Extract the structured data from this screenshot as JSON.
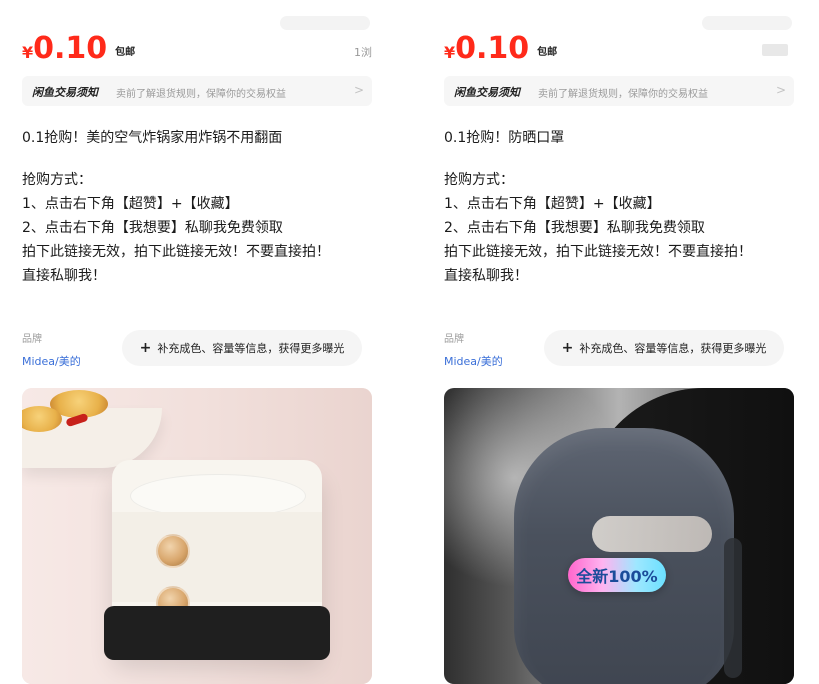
{
  "cards": [
    {
      "price_symbol": "¥",
      "price": "0.10",
      "shipping": "包邮",
      "price_meta": "1浏",
      "notice": {
        "title": "闲鱼交易须知",
        "desc": "卖前了解退货规则，保障你的交易权益",
        "chevron": ">"
      },
      "lines": [
        "0.1抢购！美的空气炸锅家用炸锅不用翻面",
        "抢购方式：",
        "1、点击右下角【超赞】+【收藏】",
        "2、点击右下角【我想要】私聊我免费领取",
        "拍下此链接无效，拍下此链接无效！不要直接拍！",
        "直接私聊我！"
      ],
      "brand_label": "品牌",
      "brand_value": "Midea/美的",
      "add_info": "补充成色、容量等信息，获得更多曝光",
      "plus": "+"
    },
    {
      "price_symbol": "¥",
      "price": "0.10",
      "shipping": "包邮",
      "notice": {
        "title": "闲鱼交易须知",
        "desc": "卖前了解退货规则，保障你的交易权益",
        "chevron": ">"
      },
      "lines": [
        "0.1抢购！防晒口罩",
        "抢购方式：",
        "1、点击右下角【超赞】+【收藏】",
        "2、点击右下角【我想要】私聊我免费领取",
        "拍下此链接无效，拍下此链接无效！不要直接拍！",
        "直接私聊我！"
      ],
      "brand_label": "品牌",
      "brand_value": "Midea/美的",
      "add_info": "补充成色、容量等信息，获得更多曝光",
      "plus": "+",
      "image_sticker": "全新100%"
    }
  ],
  "icons": {
    "chevron": "chevron-right-icon",
    "plus": "plus-icon"
  },
  "colors": {
    "price": "#ff2a1a",
    "brand_link": "#3a6fd8",
    "notice_bg": "#f6f6f6"
  }
}
